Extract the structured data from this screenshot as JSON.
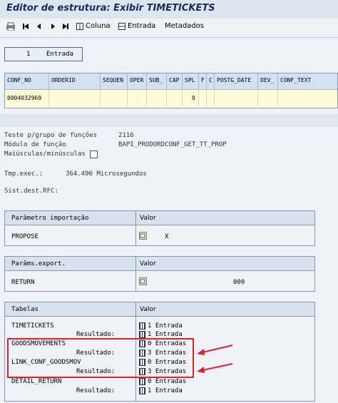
{
  "window1": {
    "title": "Editor de estrutura: Exibir TIMETICKETS",
    "toolbar": {
      "coluna": "Coluna",
      "entrada": "Entrada",
      "metadados": "Metadados"
    },
    "entry_count": "1",
    "entry_label": "Entrada",
    "columns": [
      "CONF_NO",
      "ORDERID",
      "SEQUEN",
      "OPER",
      "SUB_",
      "CAP",
      "SPL",
      "F",
      "C",
      "POSTG_DATE",
      "DEV_",
      "CONF_TEXT"
    ],
    "row": [
      "0004032969",
      "",
      "",
      "",
      "",
      "",
      "0",
      "",
      "",
      "",
      "",
      ""
    ]
  },
  "window2": {
    "test_label": "Teste p/grupo de funções",
    "test_value": "2116",
    "module_label": "Módulo de função",
    "module_value": "BAPI_PRODORDCONF_GET_TT_PROP",
    "case_label": "Maiúsculas/minúsculas",
    "exec_label": "Tmp.exec.:",
    "exec_value": "364.490 Microsegundos",
    "rfc_label": "Sist.dest.RFC:",
    "import": {
      "header": "Parâmetro importação",
      "value_header": "Valor",
      "param": "PROPOSE",
      "value": "X"
    },
    "export": {
      "header": "Parâms.export.",
      "value_header": "Valor",
      "param": "RETURN",
      "value": "000"
    },
    "tables": {
      "header": "Tabelas",
      "value_header": "Valor",
      "result_label": "Resultado:",
      "rows": [
        {
          "name": "TIMETICKETS",
          "value": "1 Entrada",
          "result": "1 Entrada"
        },
        {
          "name": "GOODSMOVEMENTS",
          "value": "0 Entradas",
          "result": "3 Entradas"
        },
        {
          "name": "LINK_CONF_GOODSMOV",
          "value": "0 Entradas",
          "result": "3 Entradas"
        },
        {
          "name": "DETAIL_RETURN",
          "value": "0 Entradas",
          "result": "1 Entrada"
        }
      ]
    }
  },
  "colors": {
    "highlight": "#e0202a",
    "header_bg": "#d2e2f2",
    "row_bg": "#fdfbd8"
  }
}
